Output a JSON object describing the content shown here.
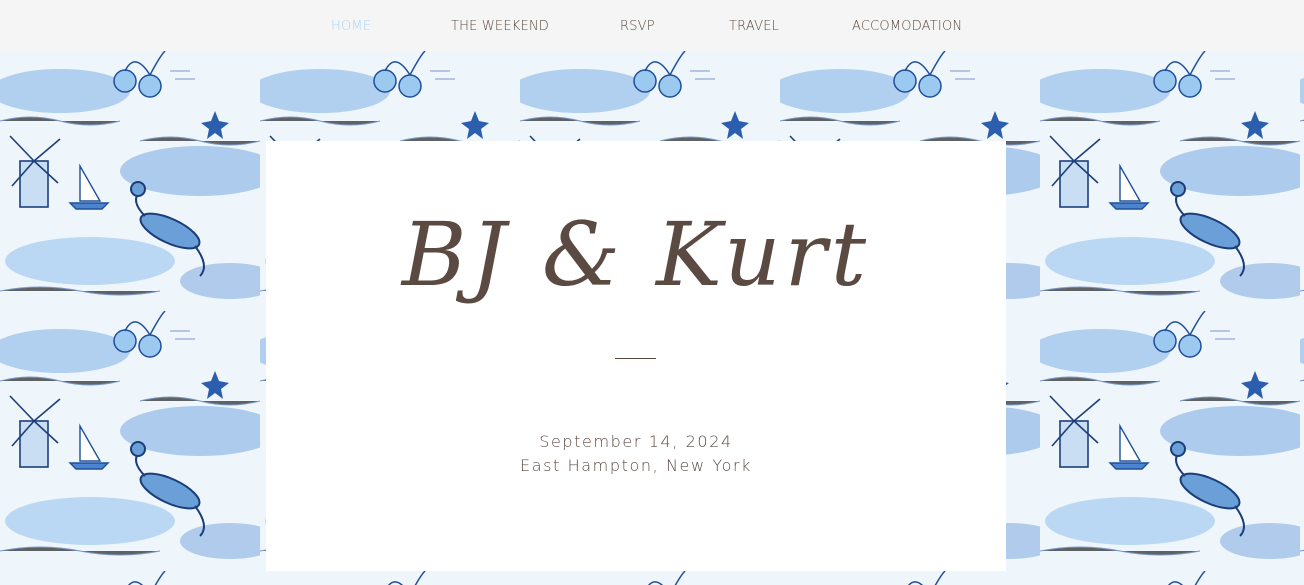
{
  "nav": {
    "items": [
      "HOME",
      "THE WEEKEND",
      "RSVP",
      "TRAVEL",
      "ACCOMODATION"
    ],
    "active": "HOME"
  },
  "hero": {
    "names": "BJ & Kurt",
    "date": "September 14, 2024",
    "location": "East Hampton, New York"
  },
  "colors": {
    "text": "#5a4a42",
    "nav_active": "#a9d4f2",
    "nav_bg": "#f5f5f5",
    "pattern_blue": "#2f6fc0"
  }
}
